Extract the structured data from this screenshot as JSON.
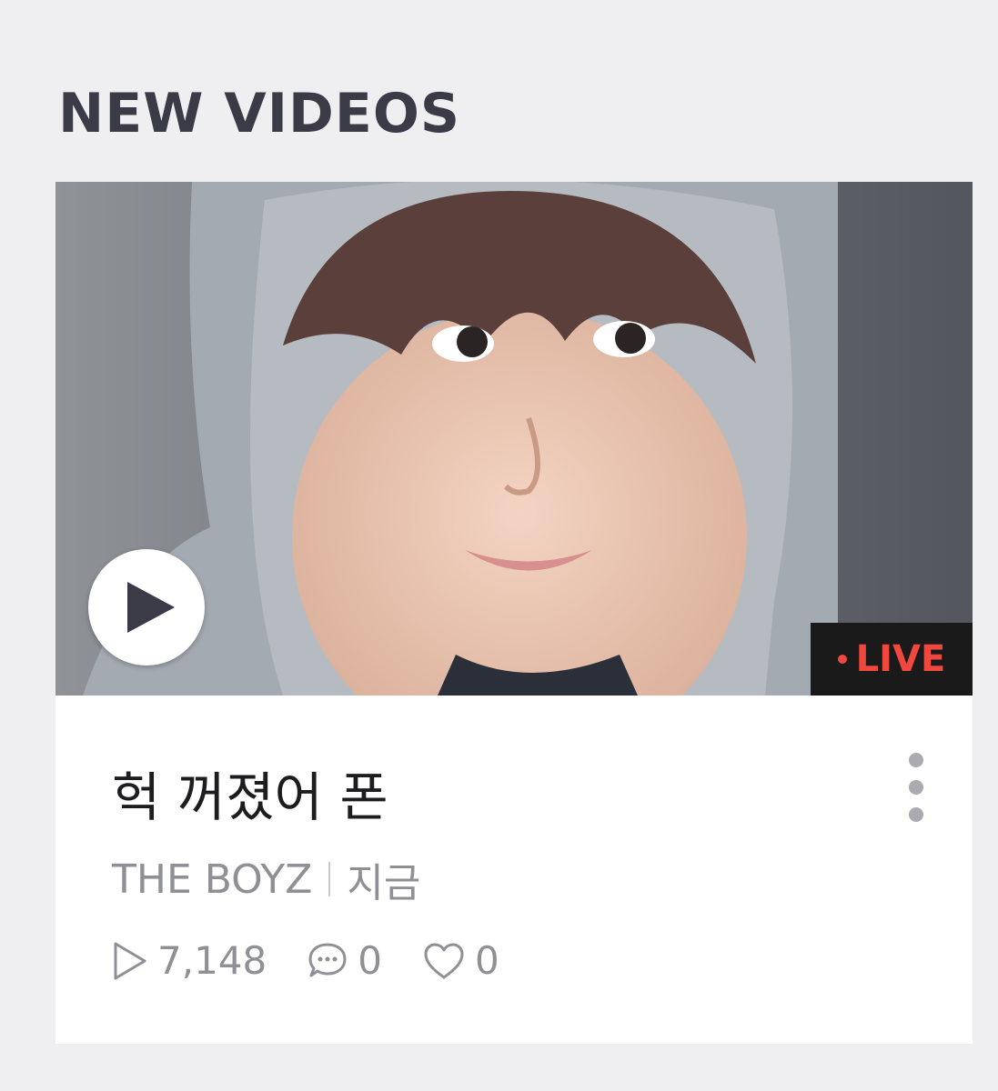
{
  "section": {
    "title": "NEW VIDEOS"
  },
  "video": {
    "title": "헉 꺼졌어 폰",
    "channel": "THE BOYZ",
    "time": "지금",
    "badge": "LIVE",
    "views": "7,148",
    "comments": "0",
    "likes": "0",
    "thumbnail_alt": "live video thumbnail"
  },
  "icons": {
    "play": "play-icon",
    "more": "more-vertical-icon",
    "views": "play-outline-icon",
    "comments": "comment-icon",
    "likes": "heart-icon"
  },
  "colors": {
    "background": "#efeff2",
    "title": "#3b3b48",
    "live": "#f0483e",
    "meta": "#8f8f96"
  }
}
